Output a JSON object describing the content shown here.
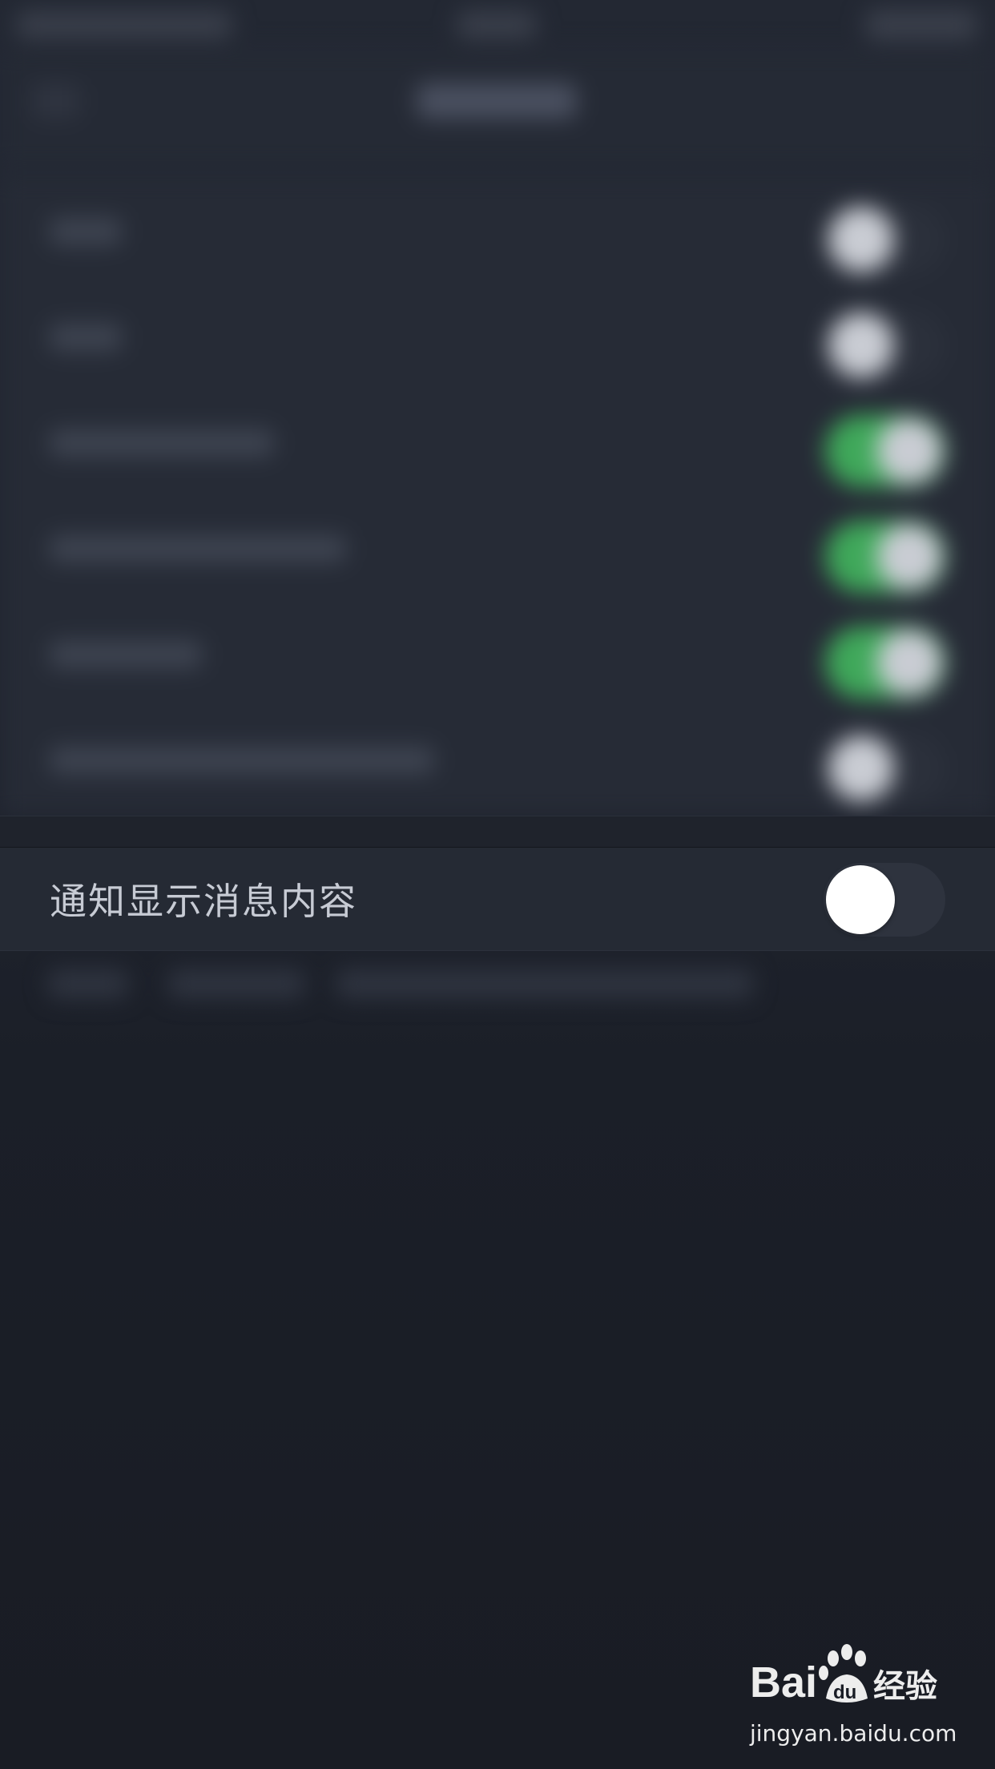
{
  "setting": {
    "label": "通知显示消息内容",
    "enabled": false
  },
  "background_rows": [
    {
      "on": false
    },
    {
      "on": false
    },
    {
      "on": true
    },
    {
      "on": true
    },
    {
      "on": true
    },
    {
      "on": false
    }
  ],
  "colors": {
    "background": "#1a1d26",
    "row_background": "#252a34",
    "toggle_off_track": "#2e333e",
    "toggle_on_track": "#3fa85a",
    "toggle_knob": "#ffffff",
    "label_text": "#c7cbd4"
  },
  "watermark": {
    "logo_text": "Bai",
    "logo_icon": "paw-icon",
    "logo_suffix": "经验",
    "url": "jingyan.baidu.com"
  }
}
